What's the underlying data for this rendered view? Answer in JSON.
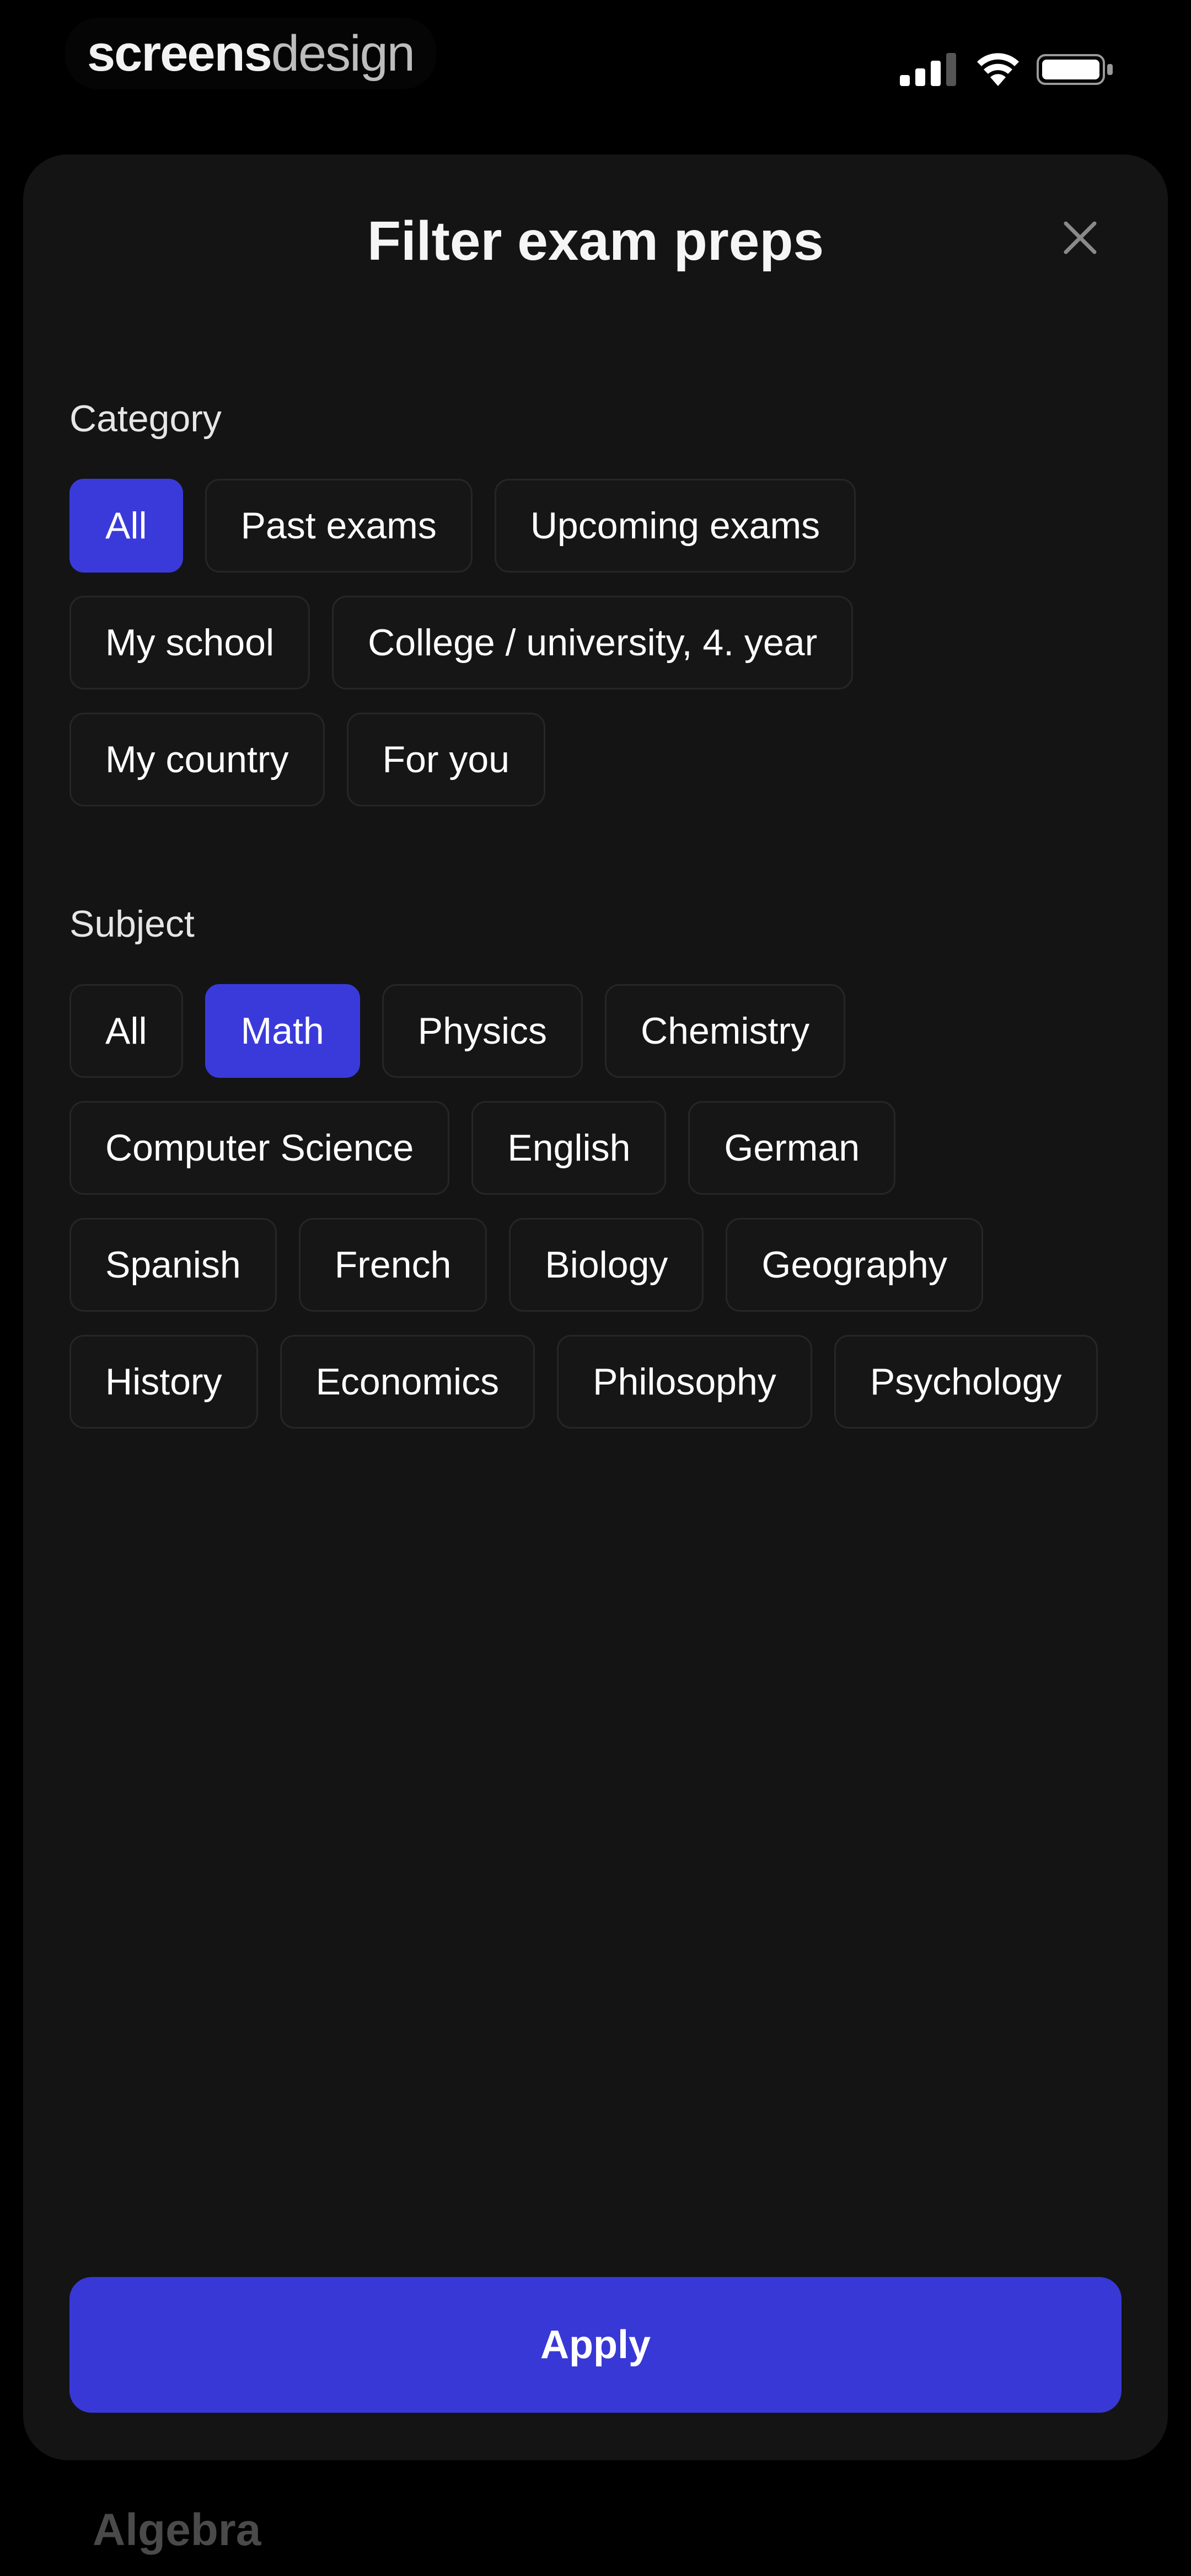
{
  "status_bar": {
    "brand_bold": "screens",
    "brand_light": "design"
  },
  "background": {
    "partial_text": "Algebra"
  },
  "sheet": {
    "title": "Filter exam preps",
    "close_icon": "close-icon",
    "apply_label": "Apply"
  },
  "category": {
    "label": "Category",
    "chips": [
      {
        "label": "All",
        "selected": true
      },
      {
        "label": "Past exams",
        "selected": false
      },
      {
        "label": "Upcoming exams",
        "selected": false
      },
      {
        "label": "My school",
        "selected": false
      },
      {
        "label": "College / university, 4. year",
        "selected": false
      },
      {
        "label": "My country",
        "selected": false
      },
      {
        "label": "For you",
        "selected": false
      }
    ]
  },
  "subject": {
    "label": "Subject",
    "chips": [
      {
        "label": "All",
        "selected": false
      },
      {
        "label": "Math",
        "selected": true
      },
      {
        "label": "Physics",
        "selected": false
      },
      {
        "label": "Chemistry",
        "selected": false
      },
      {
        "label": "Computer Science",
        "selected": false
      },
      {
        "label": "English",
        "selected": false
      },
      {
        "label": "German",
        "selected": false
      },
      {
        "label": "Spanish",
        "selected": false
      },
      {
        "label": "French",
        "selected": false
      },
      {
        "label": "Biology",
        "selected": false
      },
      {
        "label": "Geography",
        "selected": false
      },
      {
        "label": "History",
        "selected": false
      },
      {
        "label": "Economics",
        "selected": false
      },
      {
        "label": "Philosophy",
        "selected": false
      },
      {
        "label": "Psychology",
        "selected": false
      }
    ]
  },
  "colors": {
    "accent": "#3a3adb",
    "sheet_background": "#141414",
    "page_background": "#000000"
  }
}
